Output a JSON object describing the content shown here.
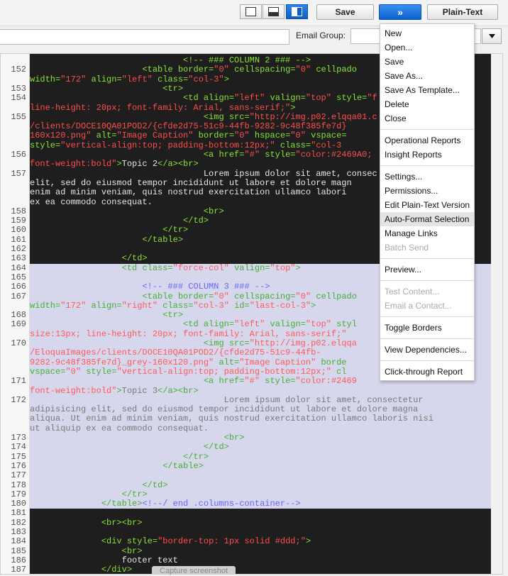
{
  "toolbar": {
    "view_buttons": [
      {
        "name": "single-pane-view",
        "active": false
      },
      {
        "name": "split-bottom-view",
        "active": false
      },
      {
        "name": "split-right-view",
        "active": true
      }
    ],
    "save_label": "Save",
    "more_label": "»",
    "plaintext_label": "Plain-Text",
    "accent": "#0b62d0"
  },
  "row2": {
    "email_group_label": "Email Group:",
    "email_group_value": ""
  },
  "menu": {
    "groups": [
      [
        {
          "label": "New"
        },
        {
          "label": "Open..."
        },
        {
          "label": "Save"
        },
        {
          "label": "Save As..."
        },
        {
          "label": "Save As Template..."
        },
        {
          "label": "Delete"
        },
        {
          "label": "Close"
        }
      ],
      [
        {
          "label": "Operational Reports"
        },
        {
          "label": "Insight Reports"
        }
      ],
      [
        {
          "label": "Settings..."
        },
        {
          "label": "Permissions..."
        },
        {
          "label": "Edit Plain-Text Version"
        },
        {
          "label": "Auto-Format Selection",
          "hover": true
        },
        {
          "label": "Manage Links"
        },
        {
          "label": "Batch Send",
          "disabled": true
        }
      ],
      [
        {
          "label": "Preview..."
        }
      ],
      [
        {
          "label": "Test Content...",
          "disabled": true
        },
        {
          "label": "Email a Contact...",
          "disabled": true
        }
      ],
      [
        {
          "label": "Toggle Borders"
        }
      ],
      [
        {
          "label": "View Dependencies..."
        }
      ],
      [
        {
          "label": "Click-through Report"
        }
      ]
    ]
  },
  "editor": {
    "lines": [
      {
        "n": "",
        "s": false,
        "tokens": [
          [
            "t",
            "                              <!-- ### COLUMN 2 ### -->"
          ]
        ]
      },
      {
        "n": "152",
        "s": false,
        "tokens": [
          [
            "p",
            "                      "
          ],
          [
            "t",
            "<table "
          ],
          [
            "a",
            "border="
          ],
          [
            "v",
            "\"0\" "
          ],
          [
            "a",
            "cellspacing="
          ],
          [
            "v",
            "\"0\" "
          ],
          [
            "a",
            "cellpado"
          ]
        ]
      },
      {
        "n": "",
        "s": false,
        "tokens": [
          [
            "a",
            "width="
          ],
          [
            "v",
            "\"172\" "
          ],
          [
            "a",
            "align="
          ],
          [
            "v",
            "\"left\" "
          ],
          [
            "a",
            "class="
          ],
          [
            "v",
            "\"col-3\""
          ],
          [
            "t",
            ">"
          ]
        ]
      },
      {
        "n": "153",
        "s": false,
        "tokens": [
          [
            "p",
            "                          "
          ],
          [
            "t",
            "<tr>"
          ]
        ]
      },
      {
        "n": "154",
        "s": false,
        "tokens": [
          [
            "p",
            "                              "
          ],
          [
            "t",
            "<td "
          ],
          [
            "a",
            "align="
          ],
          [
            "v",
            "\"left\" "
          ],
          [
            "a",
            "valign="
          ],
          [
            "v",
            "\"top\" "
          ],
          [
            "a",
            "style="
          ],
          [
            "v",
            "\"f"
          ]
        ]
      },
      {
        "n": "",
        "s": false,
        "tokens": [
          [
            "v",
            "line-height: 20px; font-family: Arial, sans-serif;\""
          ],
          [
            "t",
            ">"
          ]
        ]
      },
      {
        "n": "155",
        "s": false,
        "tokens": [
          [
            "p",
            "                                  "
          ],
          [
            "t",
            "<img "
          ],
          [
            "a",
            "src="
          ],
          [
            "v",
            "\"http://img.p02.elqqa01.c"
          ]
        ]
      },
      {
        "n": "",
        "s": false,
        "tokens": [
          [
            "v",
            "/clients/DOCE10QA01POD2/{cfde2d75-51c9-44fb-9282-9c48f385fe7d}"
          ]
        ]
      },
      {
        "n": "",
        "s": false,
        "tokens": [
          [
            "v",
            "160x120.png\" "
          ],
          [
            "a",
            "alt="
          ],
          [
            "v",
            "\"Image Caption\" "
          ],
          [
            "a",
            "border="
          ],
          [
            "v",
            "\"0\" "
          ],
          [
            "a",
            "hspace="
          ],
          [
            "v",
            "\"0\" "
          ],
          [
            "a",
            "vspace="
          ]
        ]
      },
      {
        "n": "",
        "s": false,
        "tokens": [
          [
            "a",
            "style="
          ],
          [
            "v",
            "\"vertical-align:top; padding-bottom:12px;\" "
          ],
          [
            "a",
            "class="
          ],
          [
            "v",
            "\"col-3"
          ]
        ]
      },
      {
        "n": "156",
        "s": false,
        "tokens": [
          [
            "p",
            "                                  "
          ],
          [
            "t",
            "<a "
          ],
          [
            "a",
            "href="
          ],
          [
            "v",
            "\"#\" "
          ],
          [
            "a",
            "style="
          ],
          [
            "v",
            "\"color:#2469A0; "
          ]
        ]
      },
      {
        "n": "",
        "s": false,
        "tokens": [
          [
            "v",
            "font-weight:bold\""
          ],
          [
            "t",
            ">"
          ],
          [
            "p",
            "Topic 2"
          ],
          [
            "t",
            "</a><br>"
          ]
        ]
      },
      {
        "n": "157",
        "s": false,
        "tokens": [
          [
            "p",
            "                                  Lorem ipsum dolor sit amet, consec"
          ]
        ]
      },
      {
        "n": "",
        "s": false,
        "tokens": [
          [
            "p",
            "elit, sed do eiusmod tempor incididunt ut labore et dolore magn"
          ]
        ]
      },
      {
        "n": "",
        "s": false,
        "tokens": [
          [
            "p",
            "enim ad minim veniam, quis nostrud exercitation ullamco labori"
          ]
        ]
      },
      {
        "n": "",
        "s": false,
        "tokens": [
          [
            "p",
            "ex ea commodo consequat."
          ]
        ]
      },
      {
        "n": "158",
        "s": false,
        "tokens": [
          [
            "p",
            "                                  "
          ],
          [
            "t",
            "<br>"
          ]
        ]
      },
      {
        "n": "159",
        "s": false,
        "tokens": [
          [
            "p",
            "                              "
          ],
          [
            "t",
            "</td>"
          ]
        ]
      },
      {
        "n": "160",
        "s": false,
        "tokens": [
          [
            "p",
            "                          "
          ],
          [
            "t",
            "</tr>"
          ]
        ]
      },
      {
        "n": "161",
        "s": false,
        "tokens": [
          [
            "p",
            "                      "
          ],
          [
            "t",
            "</table>"
          ]
        ]
      },
      {
        "n": "162",
        "s": false,
        "tokens": []
      },
      {
        "n": "163",
        "s": false,
        "tokens": [
          [
            "p",
            "                  "
          ],
          [
            "t",
            "</td>"
          ]
        ]
      },
      {
        "n": "164",
        "s": true,
        "tokens": [
          [
            "p",
            "                  "
          ],
          [
            "t",
            "<td "
          ],
          [
            "a",
            "class="
          ],
          [
            "v",
            "\"force-col\" "
          ],
          [
            "a",
            "valign="
          ],
          [
            "v",
            "\"top\""
          ],
          [
            "t",
            ">"
          ]
        ]
      },
      {
        "n": "165",
        "s": true,
        "tokens": []
      },
      {
        "n": "166",
        "s": true,
        "tokens": [
          [
            "p",
            "                      "
          ],
          [
            "c",
            "<!-- ### COLUMN 3 ### -->"
          ]
        ]
      },
      {
        "n": "167",
        "s": true,
        "tokens": [
          [
            "p",
            "                      "
          ],
          [
            "t",
            "<table "
          ],
          [
            "a",
            "border="
          ],
          [
            "v",
            "\"0\" "
          ],
          [
            "a",
            "cellspacing="
          ],
          [
            "v",
            "\"0\" "
          ],
          [
            "a",
            "cellpado"
          ]
        ]
      },
      {
        "n": "",
        "s": true,
        "tokens": [
          [
            "a",
            "width="
          ],
          [
            "v",
            "\"172\" "
          ],
          [
            "a",
            "align="
          ],
          [
            "v",
            "\"right\" "
          ],
          [
            "a",
            "class="
          ],
          [
            "v",
            "\"col-3\" "
          ],
          [
            "a",
            "id="
          ],
          [
            "v",
            "\"last-col-3\""
          ],
          [
            "t",
            ">"
          ]
        ]
      },
      {
        "n": "168",
        "s": true,
        "tokens": [
          [
            "p",
            "                          "
          ],
          [
            "t",
            "<tr>"
          ]
        ]
      },
      {
        "n": "169",
        "s": true,
        "tokens": [
          [
            "p",
            "                              "
          ],
          [
            "t",
            "<td "
          ],
          [
            "a",
            "align="
          ],
          [
            "v",
            "\"left\" "
          ],
          [
            "a",
            "valign="
          ],
          [
            "v",
            "\"top\" "
          ],
          [
            "a",
            "styl"
          ]
        ]
      },
      {
        "n": "",
        "s": true,
        "tokens": [
          [
            "v",
            "size:13px; line-height: 20px; font-family: Arial, sans-serif;\""
          ]
        ]
      },
      {
        "n": "170",
        "s": true,
        "tokens": [
          [
            "p",
            "                                  "
          ],
          [
            "t",
            "<img "
          ],
          [
            "a",
            "src="
          ],
          [
            "v",
            "\"http://img.p02.elqqa"
          ]
        ]
      },
      {
        "n": "",
        "s": true,
        "tokens": [
          [
            "v",
            "/EloquaImages/clients/DOCE10QA01POD2/{cfde2d75-51c9-44fb-"
          ]
        ]
      },
      {
        "n": "",
        "s": true,
        "tokens": [
          [
            "v",
            "9282-9c48f385fe7d}_grey-160x120.png\" "
          ],
          [
            "a",
            "alt="
          ],
          [
            "v",
            "\"Image Caption\" "
          ],
          [
            "a",
            "borde"
          ]
        ]
      },
      {
        "n": "",
        "s": true,
        "tokens": [
          [
            "a",
            "vspace="
          ],
          [
            "v",
            "\"0\" "
          ],
          [
            "a",
            "style="
          ],
          [
            "v",
            "\"vertical-align:top; padding-bottom:12px;\" "
          ],
          [
            "a",
            "cl"
          ]
        ]
      },
      {
        "n": "171",
        "s": true,
        "tokens": [
          [
            "p",
            "                                  "
          ],
          [
            "t",
            "<a "
          ],
          [
            "a",
            "href="
          ],
          [
            "v",
            "\"#\" "
          ],
          [
            "a",
            "style="
          ],
          [
            "v",
            "\"color:#2469"
          ]
        ]
      },
      {
        "n": "",
        "s": true,
        "tokens": [
          [
            "v",
            "font-weight:bold\""
          ],
          [
            "t",
            ">"
          ],
          [
            "p",
            "Topic 3"
          ],
          [
            "t",
            "</a><br>"
          ]
        ]
      },
      {
        "n": "172",
        "s": true,
        "tokens": [
          [
            "p",
            "                                      Lorem ipsum dolor sit amet, consectetur"
          ]
        ]
      },
      {
        "n": "",
        "s": true,
        "tokens": [
          [
            "p",
            "adipisicing elit, sed do eiusmod tempor incididunt ut labore et dolore magna"
          ]
        ]
      },
      {
        "n": "",
        "s": true,
        "tokens": [
          [
            "p",
            "aliqua. Ut enim ad minim veniam, quis nostrud exercitation ullamco laboris nisi"
          ]
        ]
      },
      {
        "n": "",
        "s": true,
        "tokens": [
          [
            "p",
            "ut aliquip ex ea commodo consequat."
          ]
        ]
      },
      {
        "n": "173",
        "s": true,
        "tokens": [
          [
            "p",
            "                                      "
          ],
          [
            "t",
            "<br>"
          ]
        ]
      },
      {
        "n": "174",
        "s": true,
        "tokens": [
          [
            "p",
            "                                  "
          ],
          [
            "t",
            "</td>"
          ]
        ]
      },
      {
        "n": "175",
        "s": true,
        "tokens": [
          [
            "p",
            "                              "
          ],
          [
            "t",
            "</tr>"
          ]
        ]
      },
      {
        "n": "176",
        "s": true,
        "tokens": [
          [
            "p",
            "                          "
          ],
          [
            "t",
            "</table>"
          ]
        ]
      },
      {
        "n": "177",
        "s": true,
        "tokens": []
      },
      {
        "n": "178",
        "s": true,
        "tokens": [
          [
            "p",
            "                      "
          ],
          [
            "t",
            "</td>"
          ]
        ]
      },
      {
        "n": "179",
        "s": true,
        "tokens": [
          [
            "p",
            "                  "
          ],
          [
            "t",
            "</tr>"
          ]
        ]
      },
      {
        "n": "180",
        "s": true,
        "tokens": [
          [
            "p",
            "              "
          ],
          [
            "t",
            "</table>"
          ],
          [
            "c",
            "<!--/ end .columns-container-->"
          ]
        ]
      },
      {
        "n": "181",
        "s": false,
        "tokens": []
      },
      {
        "n": "182",
        "s": false,
        "tokens": [
          [
            "p",
            "              "
          ],
          [
            "t",
            "<br><br>"
          ]
        ]
      },
      {
        "n": "183",
        "s": false,
        "tokens": []
      },
      {
        "n": "184",
        "s": false,
        "tokens": [
          [
            "p",
            "              "
          ],
          [
            "t",
            "<div "
          ],
          [
            "a",
            "style="
          ],
          [
            "v",
            "\"border-top: 1px solid #ddd;\""
          ],
          [
            "t",
            ">"
          ]
        ]
      },
      {
        "n": "185",
        "s": false,
        "tokens": [
          [
            "p",
            "                  "
          ],
          [
            "t",
            "<br>"
          ]
        ]
      },
      {
        "n": "186",
        "s": false,
        "tokens": [
          [
            "p",
            "                  footer text"
          ]
        ]
      },
      {
        "n": "187",
        "s": false,
        "tokens": [
          [
            "p",
            "              "
          ],
          [
            "t",
            "</div>"
          ]
        ]
      }
    ],
    "selection_color": "#d6d6ec"
  },
  "footer": {
    "capture_label": "Capture screenshot"
  }
}
